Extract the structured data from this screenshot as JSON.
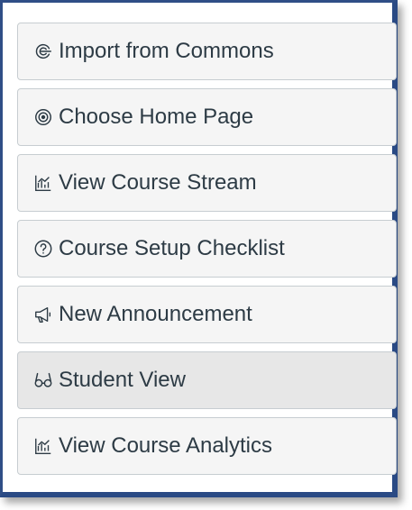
{
  "sidebar": {
    "accent_border_color": "#2f4e86",
    "items": [
      {
        "label": "Import from Commons",
        "icon": "commons-icon"
      },
      {
        "label": "Choose Home Page",
        "icon": "target-icon"
      },
      {
        "label": "View Course Stream",
        "icon": "stream-icon"
      },
      {
        "label": "Course Setup Checklist",
        "icon": "question-icon"
      },
      {
        "label": "New Announcement",
        "icon": "megaphone-icon"
      },
      {
        "label": "Student View",
        "icon": "glasses-icon",
        "state": "active"
      },
      {
        "label": "View Course Analytics",
        "icon": "analytics-icon"
      }
    ]
  }
}
